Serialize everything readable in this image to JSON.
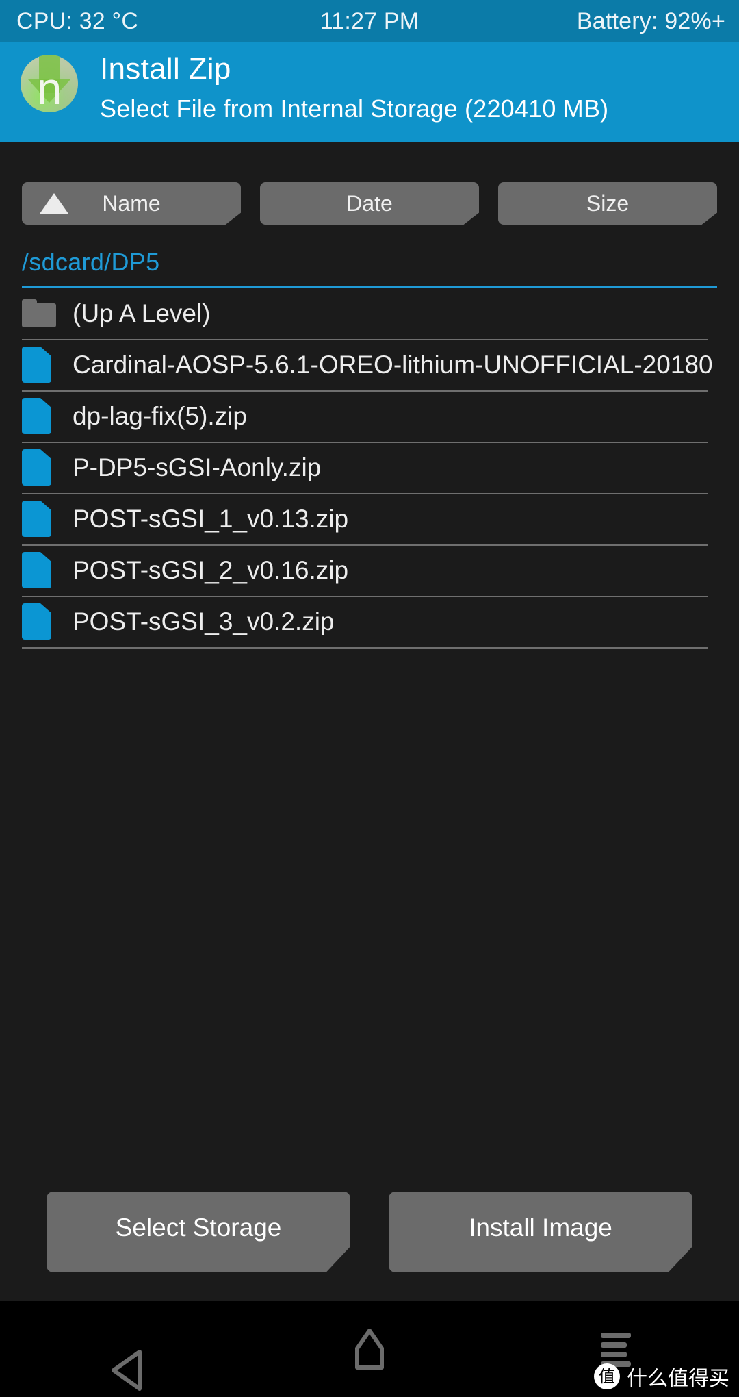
{
  "status_bar": {
    "cpu": "CPU: 32 °C",
    "clock": "11:27 PM",
    "battery": "Battery: 92%+"
  },
  "header": {
    "logo_letter": "n",
    "title": "Install Zip",
    "subtitle": "Select File from Internal Storage (220410 MB)"
  },
  "sort_bar": {
    "buttons": [
      {
        "label": "Name",
        "active": true,
        "direction": "ascending"
      },
      {
        "label": "Date",
        "active": false,
        "direction": ""
      },
      {
        "label": "Size",
        "active": false,
        "direction": ""
      }
    ]
  },
  "path": {
    "current": "/sdcard/DP5"
  },
  "file_list": [
    {
      "name": "(Up A Level)",
      "icon": "folder-icon"
    },
    {
      "name": "Cardinal-AOSP-5.6.1-OREO-lithium-UNOFFICIAL-20180",
      "icon": "file-icon"
    },
    {
      "name": "dp-lag-fix(5).zip",
      "icon": "file-icon"
    },
    {
      "name": "P-DP5-sGSI-Aonly.zip",
      "icon": "file-icon"
    },
    {
      "name": "POST-sGSI_1_v0.13.zip",
      "icon": "file-icon"
    },
    {
      "name": "POST-sGSI_2_v0.16.zip",
      "icon": "file-icon"
    },
    {
      "name": "POST-sGSI_3_v0.2.zip",
      "icon": "file-icon"
    }
  ],
  "actions": {
    "select_storage": "Select Storage",
    "install_image": "Install Image"
  },
  "nav_bar": {
    "back": "back-icon",
    "home": "home-icon",
    "menu": "menu-icon"
  },
  "watermark": {
    "mark": "值",
    "text": "什么值得买"
  },
  "colors": {
    "status_bar_blue": "#0b7ba8",
    "header_blue": "#0f93ca",
    "accent_blue": "#1f9ad6",
    "file_icon_blue": "#0b96d3",
    "background": "#1b1b1b",
    "button_gray": "#6b6b6b",
    "folder_gray": "#6f6f6f"
  }
}
